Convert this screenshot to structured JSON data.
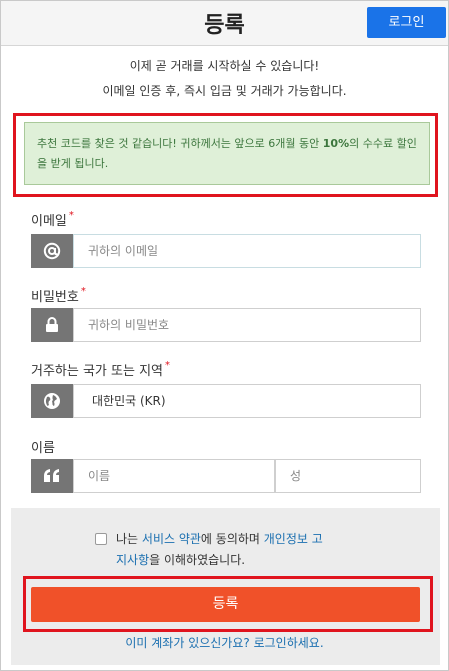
{
  "header": {
    "title": "등록",
    "login_label": "로그인"
  },
  "intro": {
    "line1": "이제 곧 거래를 시작하실 수 있습니다!",
    "line2": "이메일 인증 후, 즉시 입금 및 거래가 가능합니다."
  },
  "referral": {
    "text_before": "추천 코드를 찾은 것 같습니다! 귀하께서는 앞으로 6개월 동안 ",
    "discount": "10%",
    "text_after": "의 수수료 할인을 받게 됩니다."
  },
  "form": {
    "email": {
      "label": "이메일",
      "required": "*",
      "placeholder": "귀하의 이메일"
    },
    "password": {
      "label": "비밀번호",
      "required": "*",
      "placeholder": "귀하의 비밀번호"
    },
    "country": {
      "label": "거주하는 국가 또는 지역",
      "required": "*",
      "value": "대한민국 (KR)"
    },
    "name": {
      "label": "이름",
      "first_placeholder": "이름",
      "last_placeholder": "성"
    }
  },
  "agreement": {
    "prefix": "나는 ",
    "terms_link": "서비스 약관",
    "middle": "에 동의하며 ",
    "privacy_link_part1": "개인정보 고",
    "privacy_link_part2": "지사항",
    "suffix": "을 이해하였습니다."
  },
  "submit_label": "등록",
  "signin_link": "이미 계좌가 있으신가요? 로그인하세요.",
  "icons": {
    "email": "at-sign-icon",
    "password": "lock-icon",
    "country": "globe-icon",
    "name": "quote-icon"
  },
  "colors": {
    "primary": "#1a73e8",
    "submit": "#f05129",
    "alert_bg": "#dff0d8",
    "alert_text": "#3c763d",
    "highlight": "#e0141e",
    "addon": "#757575",
    "link": "#1a6fb0"
  }
}
